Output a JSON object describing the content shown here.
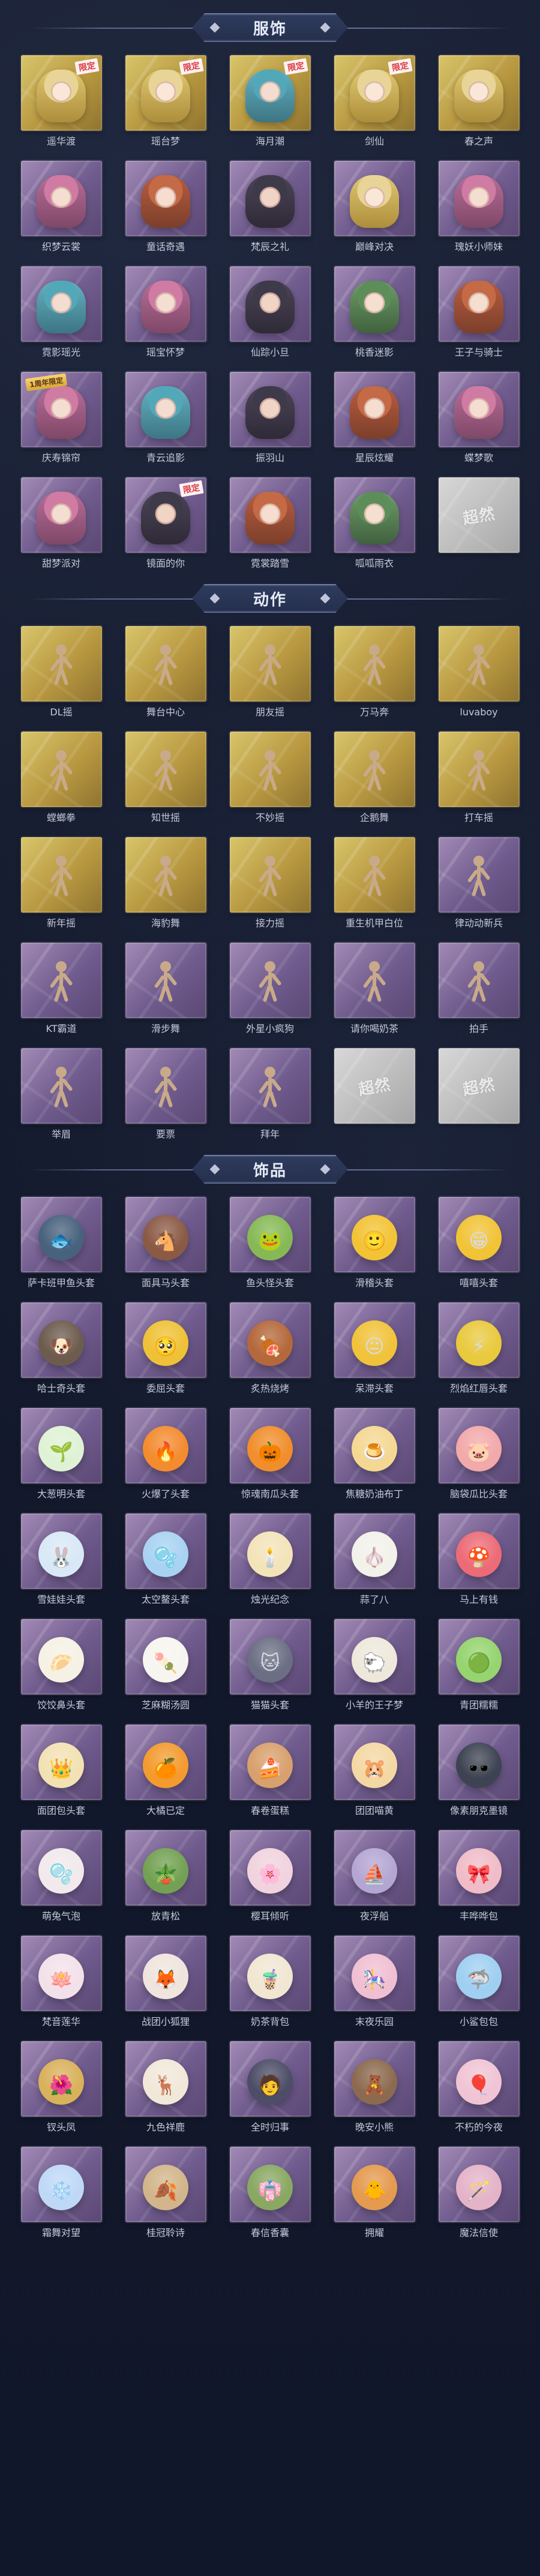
{
  "sections": [
    {
      "title": "服饰",
      "items": [
        {
          "label": "遥华渡",
          "tile": "gold",
          "style": "gold",
          "badge": "限定",
          "badge_type": "limited"
        },
        {
          "label": "瑶台梦",
          "tile": "gold",
          "style": "gold",
          "badge": "限定",
          "badge_type": "limited"
        },
        {
          "label": "海月潮",
          "tile": "gold",
          "style": "blue",
          "badge": "限定",
          "badge_type": "limited"
        },
        {
          "label": "剑仙",
          "tile": "gold",
          "style": "gold",
          "badge": "限定",
          "badge_type": "limited"
        },
        {
          "label": "春之声",
          "tile": "gold",
          "style": "gold",
          "badge": "",
          "badge_type": ""
        },
        {
          "label": "织梦云裳",
          "tile": "purple",
          "style": "pink",
          "badge": "",
          "badge_type": ""
        },
        {
          "label": "童话奇遇",
          "tile": "purple",
          "style": "orange",
          "badge": "",
          "badge_type": ""
        },
        {
          "label": "梵辰之礼",
          "tile": "purple",
          "style": "dark",
          "badge": "",
          "badge_type": ""
        },
        {
          "label": "巅峰对决",
          "tile": "purple",
          "style": "gold",
          "badge": "",
          "badge_type": ""
        },
        {
          "label": "瑰妖小师妹",
          "tile": "purple",
          "style": "pink",
          "badge": "",
          "badge_type": ""
        },
        {
          "label": "霓影瑶光",
          "tile": "purple",
          "style": "blue",
          "badge": "",
          "badge_type": ""
        },
        {
          "label": "瑶宝怀梦",
          "tile": "purple",
          "style": "pink",
          "badge": "",
          "badge_type": ""
        },
        {
          "label": "仙踪小旦",
          "tile": "purple",
          "style": "dark",
          "badge": "",
          "badge_type": ""
        },
        {
          "label": "桃香迷影",
          "tile": "purple",
          "style": "green",
          "badge": "",
          "badge_type": ""
        },
        {
          "label": "王子与骑士",
          "tile": "purple",
          "style": "orange",
          "badge": "",
          "badge_type": ""
        },
        {
          "label": "庆寿锦帘",
          "tile": "purple",
          "style": "pink",
          "badge": "1周年限定",
          "badge_type": "ribbon"
        },
        {
          "label": "青云追影",
          "tile": "purple",
          "style": "blue",
          "badge": "",
          "badge_type": ""
        },
        {
          "label": "振羽山",
          "tile": "purple",
          "style": "dark",
          "badge": "",
          "badge_type": ""
        },
        {
          "label": "星辰炫耀",
          "tile": "purple",
          "style": "orange",
          "badge": "",
          "badge_type": ""
        },
        {
          "label": "蝶梦歌",
          "tile": "purple",
          "style": "pink",
          "badge": "",
          "badge_type": ""
        },
        {
          "label": "甜梦派对",
          "tile": "purple",
          "style": "pink",
          "badge": "",
          "badge_type": ""
        },
        {
          "label": "镜面的你",
          "tile": "purple",
          "style": "dark",
          "badge": "限定",
          "badge_type": "limited"
        },
        {
          "label": "霓裳踏雪",
          "tile": "purple",
          "style": "orange",
          "badge": "",
          "badge_type": ""
        },
        {
          "label": "呱呱雨衣",
          "tile": "purple",
          "style": "green",
          "badge": "",
          "badge_type": ""
        },
        {
          "label": "",
          "tile": "blank",
          "style": "",
          "badge": "",
          "badge_type": "",
          "watermark": "超然"
        }
      ]
    },
    {
      "title": "动作",
      "items": [
        {
          "label": "DL摇",
          "tile": "gold",
          "style": "figure",
          "badge": "",
          "badge_type": ""
        },
        {
          "label": "舞台中心",
          "tile": "gold",
          "style": "figure",
          "badge": "",
          "badge_type": ""
        },
        {
          "label": "朋友摇",
          "tile": "gold",
          "style": "figure",
          "badge": "",
          "badge_type": ""
        },
        {
          "label": "万马奔",
          "tile": "gold",
          "style": "figure",
          "badge": "",
          "badge_type": ""
        },
        {
          "label": "luvaboy",
          "tile": "gold",
          "style": "figure",
          "badge": "",
          "badge_type": ""
        },
        {
          "label": "螳螂拳",
          "tile": "gold",
          "style": "figure",
          "badge": "",
          "badge_type": ""
        },
        {
          "label": "知世摇",
          "tile": "gold",
          "style": "figure",
          "badge": "",
          "badge_type": ""
        },
        {
          "label": "不妙摇",
          "tile": "gold",
          "style": "figure",
          "badge": "",
          "badge_type": ""
        },
        {
          "label": "企鹅舞",
          "tile": "gold",
          "style": "figure",
          "badge": "",
          "badge_type": ""
        },
        {
          "label": "打车摇",
          "tile": "gold",
          "style": "figure",
          "badge": "",
          "badge_type": ""
        },
        {
          "label": "新年摇",
          "tile": "gold",
          "style": "figure",
          "badge": "",
          "badge_type": ""
        },
        {
          "label": "海豹舞",
          "tile": "gold",
          "style": "figure",
          "badge": "",
          "badge_type": ""
        },
        {
          "label": "接力摇",
          "tile": "gold",
          "style": "figure",
          "badge": "",
          "badge_type": ""
        },
        {
          "label": "重生机甲白位",
          "tile": "gold",
          "style": "figure",
          "badge": "",
          "badge_type": ""
        },
        {
          "label": "律动动新兵",
          "tile": "purple",
          "style": "figure",
          "badge": "",
          "badge_type": ""
        },
        {
          "label": "KT霸道",
          "tile": "purple",
          "style": "figure",
          "badge": "",
          "badge_type": ""
        },
        {
          "label": "滑步舞",
          "tile": "purple",
          "style": "figure",
          "badge": "",
          "badge_type": ""
        },
        {
          "label": "外星小疯狗",
          "tile": "purple",
          "style": "figure",
          "badge": "",
          "badge_type": ""
        },
        {
          "label": "请你喝奶茶",
          "tile": "purple",
          "style": "figure",
          "badge": "",
          "badge_type": ""
        },
        {
          "label": "拍手",
          "tile": "purple",
          "style": "figure",
          "badge": "",
          "badge_type": ""
        },
        {
          "label": "举眉",
          "tile": "purple",
          "style": "figure",
          "badge": "",
          "badge_type": ""
        },
        {
          "label": "要票",
          "tile": "purple",
          "style": "figure",
          "badge": "",
          "badge_type": ""
        },
        {
          "label": "拜年",
          "tile": "purple",
          "style": "figure",
          "badge": "",
          "badge_type": ""
        },
        {
          "label": "",
          "tile": "blank",
          "style": "",
          "badge": "",
          "badge_type": "",
          "watermark": "超然"
        },
        {
          "label": "",
          "tile": "blank",
          "style": "",
          "badge": "",
          "badge_type": "",
          "watermark": "超然"
        }
      ]
    },
    {
      "title": "饰品",
      "items": [
        {
          "label": "萨卡班甲鱼头套",
          "tile": "purple",
          "style": "mask",
          "mask": "🐟",
          "mask_color": "#48627d",
          "badge": "",
          "badge_type": ""
        },
        {
          "label": "面具马头套",
          "tile": "purple",
          "style": "mask",
          "mask": "🐴",
          "mask_color": "#8b5a45",
          "badge": "",
          "badge_type": ""
        },
        {
          "label": "鱼头怪头套",
          "tile": "purple",
          "style": "mask",
          "mask": "🐸",
          "mask_color": "#86b956",
          "badge": "",
          "badge_type": ""
        },
        {
          "label": "滑稽头套",
          "tile": "purple",
          "style": "mask",
          "mask": "🙂",
          "mask_color": "#f2c335",
          "badge": "",
          "badge_type": ""
        },
        {
          "label": "嘻嘻头套",
          "tile": "purple",
          "style": "mask",
          "mask": "😁",
          "mask_color": "#f1c336",
          "badge": "",
          "badge_type": ""
        },
        {
          "label": "哈士奇头套",
          "tile": "purple",
          "style": "mask",
          "mask": "🐶",
          "mask_color": "#6d5b4e",
          "badge": "",
          "badge_type": ""
        },
        {
          "label": "委屈头套",
          "tile": "purple",
          "style": "mask",
          "mask": "🥺",
          "mask_color": "#efc137",
          "badge": "",
          "badge_type": ""
        },
        {
          "label": "炙热烧烤",
          "tile": "purple",
          "style": "mask",
          "mask": "🍖",
          "mask_color": "#b4683b",
          "badge": "",
          "badge_type": ""
        },
        {
          "label": "呆滞头套",
          "tile": "purple",
          "style": "mask",
          "mask": "😐",
          "mask_color": "#f0c33a",
          "badge": "",
          "badge_type": ""
        },
        {
          "label": "烈焰红唇头套",
          "tile": "purple",
          "style": "mask",
          "mask": "⚡",
          "mask_color": "#e9c93d",
          "badge": "",
          "badge_type": ""
        },
        {
          "label": "大葱明头套",
          "tile": "purple",
          "style": "mask",
          "mask": "🌱",
          "mask_color": "#dff2d5",
          "badge": "",
          "badge_type": ""
        },
        {
          "label": "火爆了头套",
          "tile": "purple",
          "style": "mask",
          "mask": "🔥",
          "mask_color": "#f38b2f",
          "badge": "",
          "badge_type": ""
        },
        {
          "label": "惊魂南瓜头套",
          "tile": "purple",
          "style": "mask",
          "mask": "🎃",
          "mask_color": "#f08e2c",
          "badge": "",
          "badge_type": ""
        },
        {
          "label": "焦糖奶油布丁",
          "tile": "purple",
          "style": "mask",
          "mask": "🍮",
          "mask_color": "#f4d892",
          "badge": "",
          "badge_type": ""
        },
        {
          "label": "脑袋瓜比头套",
          "tile": "purple",
          "style": "mask",
          "mask": "🐷",
          "mask_color": "#f2a9aa",
          "badge": "",
          "badge_type": ""
        },
        {
          "label": "雪娃娃头套",
          "tile": "purple",
          "style": "mask",
          "mask": "🐰",
          "mask_color": "#d9e8f6",
          "badge": "",
          "badge_type": ""
        },
        {
          "label": "太空鳌头套",
          "tile": "purple",
          "style": "mask",
          "mask": "🫧",
          "mask_color": "#a8d2f2",
          "badge": "",
          "badge_type": ""
        },
        {
          "label": "烛光纪念",
          "tile": "purple",
          "style": "mask",
          "mask": "🕯️",
          "mask_color": "#f3e3b9",
          "badge": "",
          "badge_type": ""
        },
        {
          "label": "蒜了八",
          "tile": "purple",
          "style": "mask",
          "mask": "🧄",
          "mask_color": "#f2f1ea",
          "badge": "",
          "badge_type": ""
        },
        {
          "label": "马上有钱",
          "tile": "purple",
          "style": "mask",
          "mask": "🍄",
          "mask_color": "#ec6b77",
          "badge": "",
          "badge_type": ""
        },
        {
          "label": "饺饺鼻头套",
          "tile": "purple",
          "style": "mask",
          "mask": "🥟",
          "mask_color": "#f5f1e4",
          "badge": "",
          "badge_type": ""
        },
        {
          "label": "芝麻糊汤圆",
          "tile": "purple",
          "style": "mask",
          "mask": "🍡",
          "mask_color": "#f7f5ef",
          "badge": "",
          "badge_type": ""
        },
        {
          "label": "猫猫头套",
          "tile": "purple",
          "style": "mask",
          "mask": "🐱",
          "mask_color": "#6c6e84",
          "badge": "",
          "badge_type": ""
        },
        {
          "label": "小羊的王子梦",
          "tile": "purple",
          "style": "mask",
          "mask": "🐑",
          "mask_color": "#eee8dc",
          "badge": "",
          "badge_type": ""
        },
        {
          "label": "青团糯糯",
          "tile": "purple",
          "style": "mask",
          "mask": "🟢",
          "mask_color": "#95d46f",
          "badge": "",
          "badge_type": ""
        },
        {
          "label": "面团包头套",
          "tile": "purple",
          "style": "mask",
          "mask": "👑",
          "mask_color": "#f2e1b3",
          "badge": "",
          "badge_type": ""
        },
        {
          "label": "大橘已定",
          "tile": "purple",
          "style": "mask",
          "mask": "🍊",
          "mask_color": "#f39b2f",
          "badge": "",
          "badge_type": ""
        },
        {
          "label": "春卷蛋糕",
          "tile": "purple",
          "style": "mask",
          "mask": "🍰",
          "mask_color": "#d8a06d",
          "badge": "",
          "badge_type": ""
        },
        {
          "label": "团团喵黄",
          "tile": "purple",
          "style": "mask",
          "mask": "🐹",
          "mask_color": "#f4d8a3",
          "badge": "",
          "badge_type": ""
        },
        {
          "label": "像素朋克墨镜",
          "tile": "purple",
          "style": "mask",
          "mask": "🕶️",
          "mask_color": "#3d4352",
          "badge": "",
          "badge_type": ""
        },
        {
          "label": "萌兔气泡",
          "tile": "purple",
          "style": "mask",
          "mask": "🫧",
          "mask_color": "#f1e9ec",
          "badge": "",
          "badge_type": ""
        },
        {
          "label": "放青松",
          "tile": "purple",
          "style": "mask",
          "mask": "🪴",
          "mask_color": "#73a153",
          "badge": "",
          "badge_type": ""
        },
        {
          "label": "樱耳倾听",
          "tile": "purple",
          "style": "mask",
          "mask": "🌸",
          "mask_color": "#f0d3de",
          "badge": "",
          "badge_type": ""
        },
        {
          "label": "夜浮船",
          "tile": "purple",
          "style": "mask",
          "mask": "⛵",
          "mask_color": "#b4a6d3",
          "badge": "",
          "badge_type": ""
        },
        {
          "label": "丰哗哗包",
          "tile": "purple",
          "style": "mask",
          "mask": "🎀",
          "mask_color": "#f0bcc8",
          "badge": "",
          "badge_type": ""
        },
        {
          "label": "梵音莲华",
          "tile": "purple",
          "style": "mask",
          "mask": "🪷",
          "mask_color": "#f3e1ea",
          "badge": "",
          "badge_type": ""
        },
        {
          "label": "战团小狐狸",
          "tile": "purple",
          "style": "mask",
          "mask": "🦊",
          "mask_color": "#f0e4dd",
          "badge": "",
          "badge_type": ""
        },
        {
          "label": "奶茶背包",
          "tile": "purple",
          "style": "mask",
          "mask": "🧋",
          "mask_color": "#f1e6d2",
          "badge": "",
          "badge_type": ""
        },
        {
          "label": "末夜乐园",
          "tile": "purple",
          "style": "mask",
          "mask": "🎠",
          "mask_color": "#f0bfd2",
          "badge": "",
          "badge_type": ""
        },
        {
          "label": "小鲨包包",
          "tile": "purple",
          "style": "mask",
          "mask": "🦈",
          "mask_color": "#9fcff1",
          "badge": "",
          "badge_type": ""
        },
        {
          "label": "钗头凤",
          "tile": "purple",
          "style": "mask",
          "mask": "🌺",
          "mask_color": "#d8b15b",
          "badge": "",
          "badge_type": ""
        },
        {
          "label": "九色祥鹿",
          "tile": "purple",
          "style": "mask",
          "mask": "🦌",
          "mask_color": "#f1e8d9",
          "badge": "",
          "badge_type": ""
        },
        {
          "label": "全时归事",
          "tile": "purple",
          "style": "mask",
          "mask": "🧑",
          "mask_color": "#4d4d67",
          "badge": "",
          "badge_type": ""
        },
        {
          "label": "晚安小熊",
          "tile": "purple",
          "style": "mask",
          "mask": "🧸",
          "mask_color": "#8c6a4f",
          "badge": "",
          "badge_type": ""
        },
        {
          "label": "不朽的今夜",
          "tile": "purple",
          "style": "mask",
          "mask": "🎈",
          "mask_color": "#f0c4d4",
          "badge": "",
          "badge_type": ""
        },
        {
          "label": "霜舞对望",
          "tile": "purple",
          "style": "mask",
          "mask": "❄️",
          "mask_color": "#bfd8f6",
          "badge": "",
          "badge_type": ""
        },
        {
          "label": "桂冠聆诗",
          "tile": "purple",
          "style": "mask",
          "mask": "🍂",
          "mask_color": "#d2b58a",
          "badge": "",
          "badge_type": ""
        },
        {
          "label": "春信香囊",
          "tile": "purple",
          "style": "mask",
          "mask": "👘",
          "mask_color": "#89a862",
          "badge": "",
          "badge_type": ""
        },
        {
          "label": "拥耀",
          "tile": "purple",
          "style": "mask",
          "mask": "🐥",
          "mask_color": "#e49a4f",
          "badge": "",
          "badge_type": ""
        },
        {
          "label": "魔法信使",
          "tile": "purple",
          "style": "mask",
          "mask": "🪄",
          "mask_color": "#e4b3c8",
          "badge": "",
          "badge_type": ""
        }
      ]
    }
  ]
}
